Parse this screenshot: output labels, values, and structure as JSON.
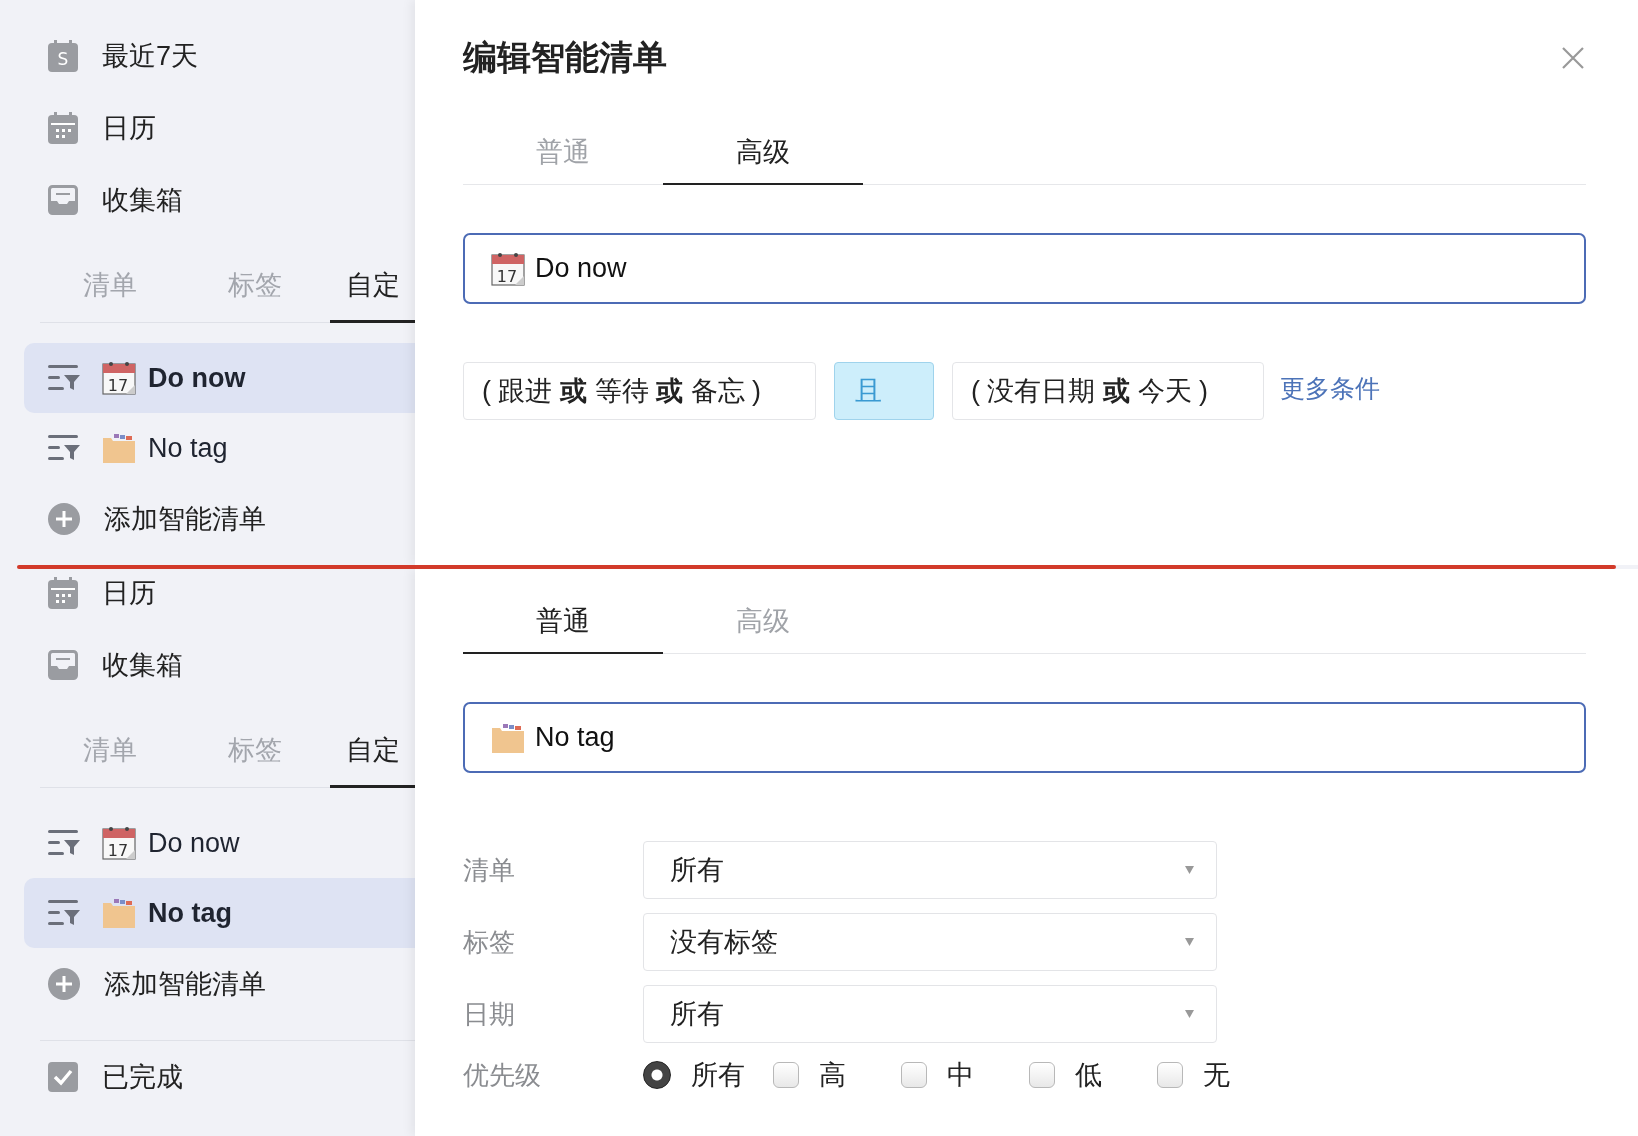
{
  "screens": [
    {
      "sidebar": {
        "nav_items": [
          {
            "kind": "week",
            "icon_text": "S",
            "label": "最近7天"
          },
          {
            "kind": "calendar",
            "label": "日历"
          },
          {
            "kind": "inbox",
            "label": "收集箱"
          }
        ],
        "tabs": [
          {
            "label": "清单",
            "selected": false
          },
          {
            "label": "标签",
            "selected": false
          },
          {
            "label": "自定",
            "selected": true
          }
        ],
        "smart_lists": [
          {
            "kind": "calendar",
            "icon_text": "17",
            "label": "Do now",
            "selected": true
          },
          {
            "kind": "box",
            "label": "No tag",
            "selected": false
          }
        ],
        "add_label": "添加智能清单"
      },
      "dialog": {
        "title": "编辑智能清单",
        "tabs": [
          {
            "label": "普通",
            "selected": false
          },
          {
            "label": "高级",
            "selected": true
          }
        ],
        "name_field": {
          "kind": "calendar",
          "icon_text": "17",
          "value": "Do now"
        },
        "conditions": [
          {
            "kind": "group",
            "text": "( 跟进 **或** 等待 **或** 备忘 )"
          },
          {
            "kind": "operator",
            "text": "且"
          },
          {
            "kind": "group",
            "text": "( 没有日期 **或** 今天 )"
          }
        ],
        "more_link": "更多条件"
      }
    },
    {
      "sidebar": {
        "nav_items": [
          {
            "kind": "calendar",
            "label": "日历"
          },
          {
            "kind": "inbox",
            "label": "收集箱"
          }
        ],
        "tabs": [
          {
            "label": "清单",
            "selected": false
          },
          {
            "label": "标签",
            "selected": false
          },
          {
            "label": "自定",
            "selected": true
          }
        ],
        "smart_lists": [
          {
            "kind": "calendar",
            "icon_text": "17",
            "label": "Do now",
            "selected": false
          },
          {
            "kind": "box",
            "label": "No tag",
            "selected": true
          }
        ],
        "add_label": "添加智能清单",
        "footer_items": [
          {
            "kind": "done",
            "label": "已完成"
          }
        ]
      },
      "dialog": {
        "tabs": [
          {
            "label": "普通",
            "selected": true
          },
          {
            "label": "高级",
            "selected": false
          }
        ],
        "name_field": {
          "kind": "box",
          "value": "No tag"
        },
        "filters": [
          {
            "label": "清单",
            "value": "所有"
          },
          {
            "label": "标签",
            "value": "没有标签"
          },
          {
            "label": "日期",
            "value": "所有"
          }
        ],
        "priority": {
          "label": "优先级",
          "options": [
            {
              "kind": "radio",
              "label": "所有",
              "checked": true
            },
            {
              "kind": "checkbox",
              "label": "高",
              "checked": false
            },
            {
              "kind": "checkbox",
              "label": "中",
              "checked": false
            },
            {
              "kind": "checkbox",
              "label": "低",
              "checked": false
            },
            {
              "kind": "checkbox",
              "label": "无",
              "checked": false
            }
          ]
        }
      }
    }
  ]
}
